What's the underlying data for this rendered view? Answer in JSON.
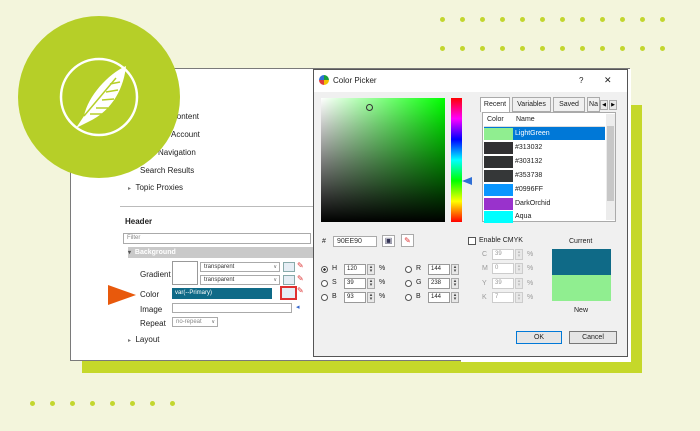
{
  "colors": {
    "background": "#f3f5dc",
    "accent_green": "#c5d82a",
    "logo_green": "#b6cf28",
    "selection_blue": "#0078d7",
    "arrow_orange": "#e8590c"
  },
  "left_panel": {
    "tree_items": [
      "Content",
      "Account",
      "Navigation",
      "Search Results",
      "Topic Proxies"
    ],
    "header_title": "Header",
    "filter_placeholder": "Filter",
    "group_label": "Background",
    "gradient_label": "Gradient",
    "gradient_value_1": "transparent",
    "gradient_value_2": "transparent",
    "color_label": "Color",
    "color_value": "var(--Primary)",
    "image_label": "Image",
    "repeat_label": "Repeat",
    "repeat_value": "no-repeat",
    "layout_label": "Layout"
  },
  "color_picker": {
    "title": "Color Picker",
    "help": "?",
    "close": "✕",
    "tabs": [
      "Recent",
      "Variables",
      "Saved",
      "Na"
    ],
    "table_headers": [
      "Color",
      "Name"
    ],
    "recent": [
      {
        "name": "LightGreen",
        "color": "#90ee90",
        "selected": true
      },
      {
        "name": "#313032",
        "color": "#313032"
      },
      {
        "name": "#303132",
        "color": "#303132"
      },
      {
        "name": "#353738",
        "color": "#353738"
      },
      {
        "name": "#0996FF",
        "color": "#0996ff"
      },
      {
        "name": "DarkOrchid",
        "color": "#9932cc"
      },
      {
        "name": "Aqua",
        "color": "#00ffff"
      }
    ],
    "hash_label": "#",
    "hex_value": "90EE90",
    "enable_cmyk_label": "Enable CMYK",
    "h_label": "H",
    "h_value": "120",
    "s_label": "S",
    "s_value": "39",
    "b_label": "B",
    "b_value": "93",
    "percent": "%",
    "r_label": "R",
    "r_value": "144",
    "g_label": "G",
    "g_value": "238",
    "bl_label": "B",
    "bl_value": "144",
    "c_label": "C",
    "c_value": "39",
    "m_label": "M",
    "m_value": "0",
    "y_label": "Y",
    "y_value": "39",
    "k_label": "K",
    "k_value": "7",
    "current_label": "Current",
    "new_label": "New",
    "current_color": "#0f6a87",
    "new_color": "#90ee90",
    "ok_label": "OK",
    "cancel_label": "Cancel",
    "hue_level": 0.33
  }
}
